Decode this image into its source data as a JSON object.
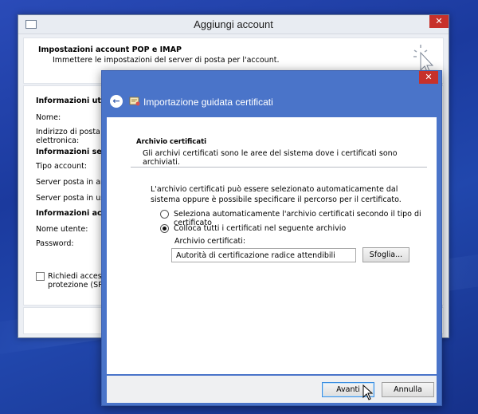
{
  "back_window": {
    "title": "Aggiungi account",
    "header_title": "Impostazioni account POP e IMAP",
    "header_subtitle": "Immettere le impostazioni del server di posta per l'account.",
    "labels": {
      "user_info": "Informazioni utente",
      "name": "Nome:",
      "email": "Indirizzo di posta",
      "email_line2": "elettronica:",
      "server_info": "Informazioni server",
      "account_type": "Tipo account:",
      "incoming": "Server posta in arrivo",
      "outgoing": "Server posta in uscita",
      "access_info": "Informazioni accesso",
      "username": "Nome utente:",
      "password": "Password:",
      "spa": "Richiedi accesso c",
      "spa_line2": "protezione (SPA)"
    },
    "close_glyph": "✕"
  },
  "wizard": {
    "title": "Importazione guidata certificati",
    "close_glyph": "✕",
    "back_glyph": "←",
    "section_title": "Archivio certificati",
    "section_subtitle": "Gli archivi certificati sono le aree del sistema dove i certificati sono archiviati.",
    "description": "L'archivio certificati può essere selezionato automaticamente dal sistema oppure è possibile specificare il percorso per il certificato.",
    "options": {
      "auto": "Seleziona automaticamente l'archivio certificati secondo il tipo di certificato",
      "manual": "Colloca tutti i certificati nel seguente archivio"
    },
    "selected_option": "manual",
    "store_label": "Archivio certificati:",
    "store_value": "Autorità di certificazione radice attendibili",
    "browse_button": "Sfoglia...",
    "next_button": "Avanti",
    "cancel_button": "Annulla"
  },
  "colors": {
    "wizard_chrome": "#4a74c9",
    "close_red": "#c7312a",
    "desktop": "#1b3a9e"
  }
}
